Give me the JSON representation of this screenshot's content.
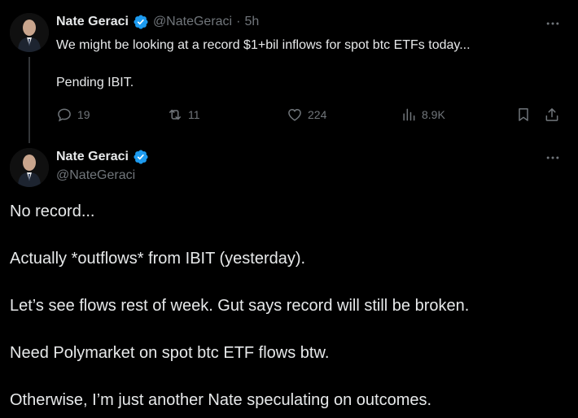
{
  "colors": {
    "background": "#000000",
    "text": "#e7e9ea",
    "muted": "#71767b",
    "verified_badge": "#1d9bf0",
    "thread_line": "#333639"
  },
  "reply_parent": {
    "author": {
      "display_name": "Nate Geraci",
      "handle": "@NateGeraci",
      "verified_icon": "verified-badge-icon"
    },
    "separator": "·",
    "time": "5h",
    "text_line_1": "We might be looking at a record $1+bil inflows for spot btc ETFs today...",
    "text_line_2": "Pending IBIT.",
    "actions": {
      "replies": "19",
      "reposts": "11",
      "likes": "224",
      "views": "8.9K"
    }
  },
  "main_tweet": {
    "author": {
      "display_name": "Nate Geraci",
      "handle": "@NateGeraci",
      "verified_icon": "verified-badge-icon"
    },
    "paragraphs": [
      "No record...",
      "Actually *outflows* from IBIT (yesterday).",
      "Let’s see flows rest of week. Gut says record will still be broken.",
      "Need Polymarket on spot btc ETF flows btw.",
      "Otherwise, I’m just another Nate speculating on outcomes."
    ]
  }
}
